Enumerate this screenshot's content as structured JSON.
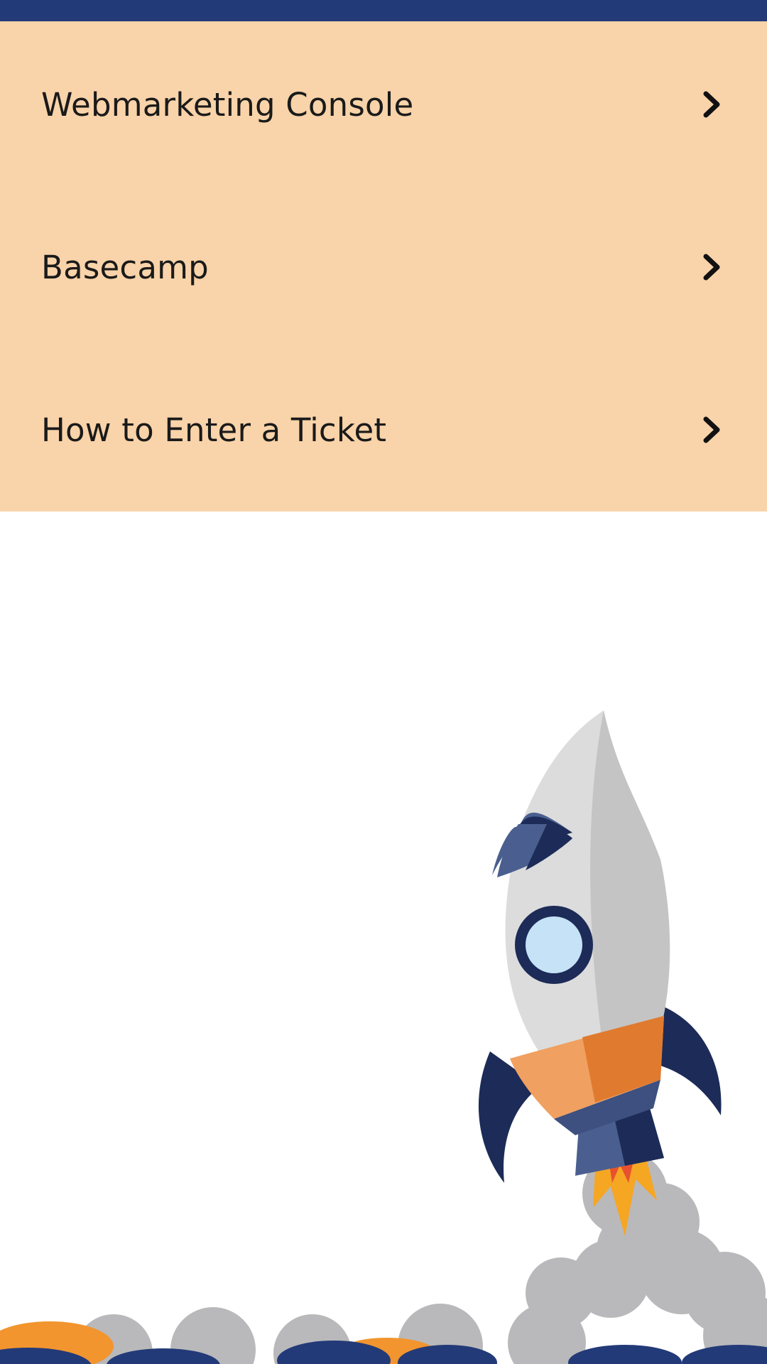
{
  "menu": {
    "items": [
      {
        "label": "Webmarketing Console",
        "icon": "chevron-right-icon"
      },
      {
        "label": "Basecamp",
        "icon": "chevron-right-icon"
      },
      {
        "label": "How to Enter a Ticket",
        "icon": "chevron-right-icon"
      }
    ]
  },
  "colors": {
    "topbar": "#233a78",
    "menu_background": "#f9d3a9",
    "rocket_orange": "#e07a2f",
    "rocket_navy": "#1c2b57"
  },
  "illustration": {
    "icon": "rocket-launch-illustration"
  }
}
